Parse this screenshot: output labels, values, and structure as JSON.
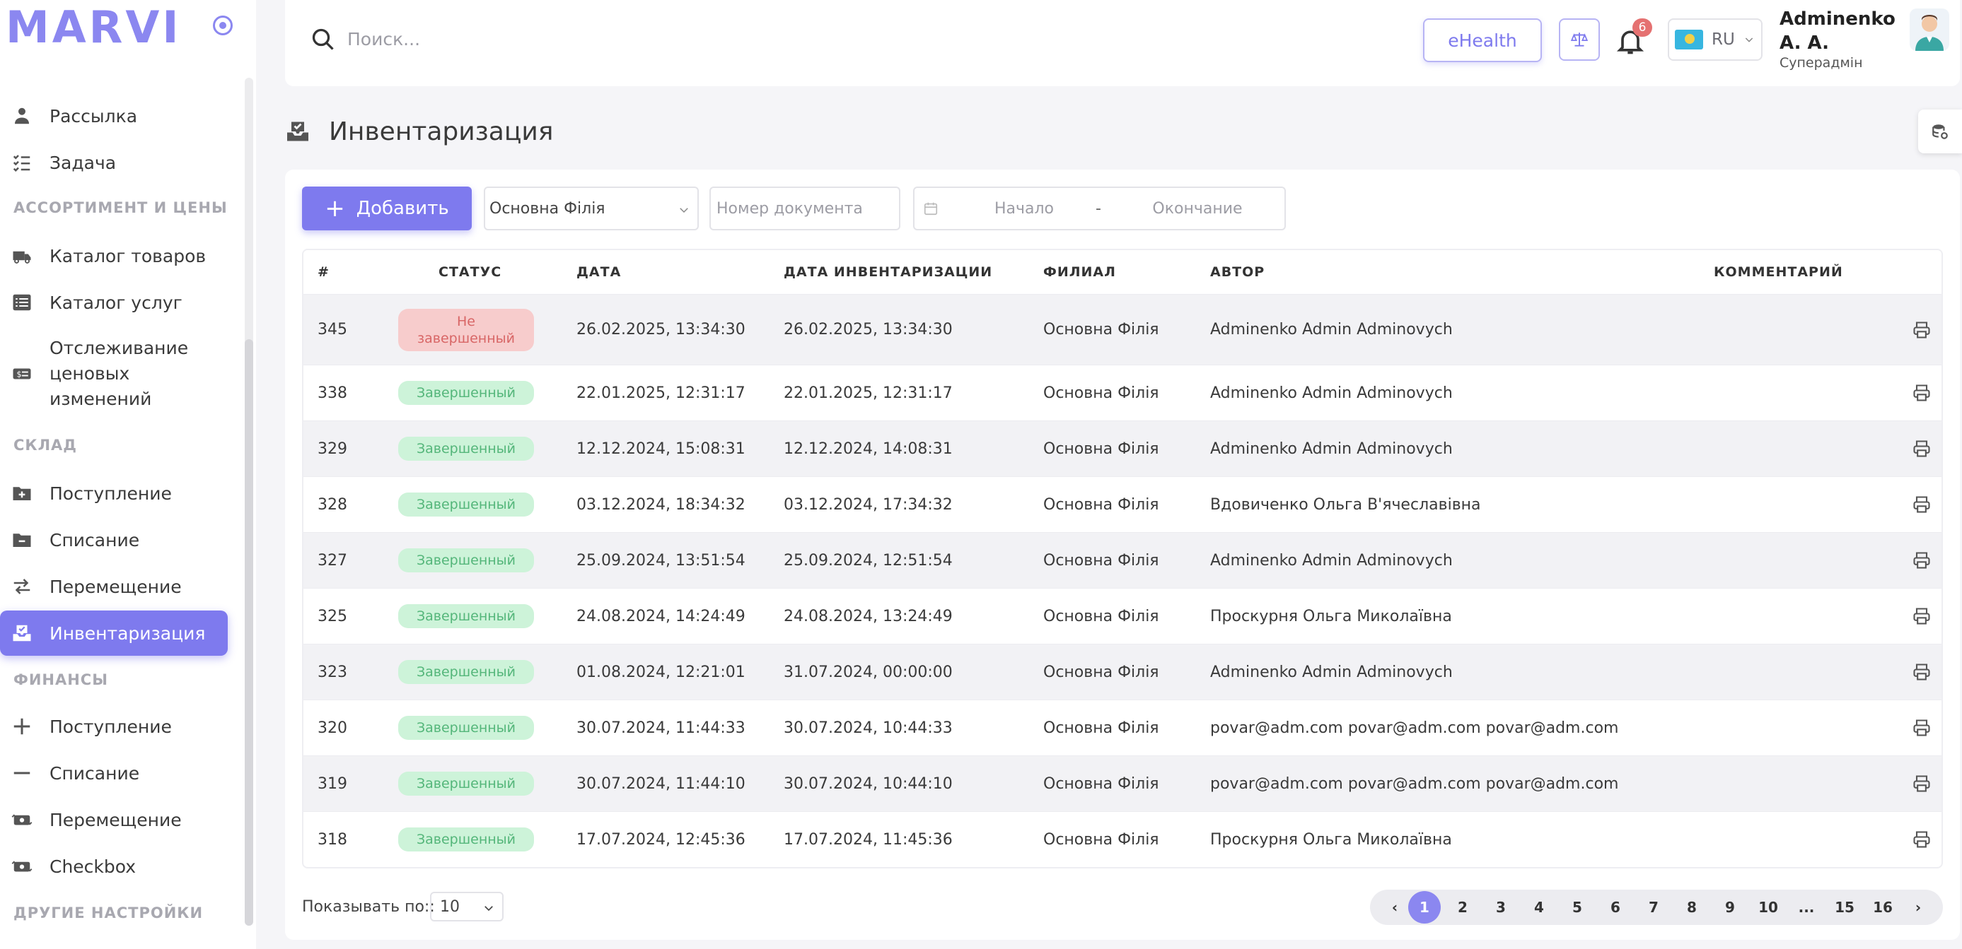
{
  "logo": "MARVI",
  "sidebar": {
    "items": [
      {
        "label": "Рассылка",
        "icon": "person-icon"
      },
      {
        "label": "Задача",
        "icon": "checklist-icon"
      },
      {
        "label": "Каталог товаров",
        "icon": "truck-icon"
      },
      {
        "label": "Каталог услуг",
        "icon": "list-icon"
      },
      {
        "label_lines": [
          "Отслеживание",
          "ценовых",
          "изменений"
        ],
        "icon": "money-icon"
      },
      {
        "label": "Поступление",
        "icon": "folder-plus-icon"
      },
      {
        "label": "Списание",
        "icon": "folder-minus-icon"
      },
      {
        "label": "Перемещение",
        "icon": "transfer-icon"
      },
      {
        "label": "Инвентаризация",
        "icon": "inventory-icon",
        "active": true
      },
      {
        "label": "Поступление",
        "icon": "plus-icon"
      },
      {
        "label": "Списание",
        "icon": "minus-icon"
      },
      {
        "label": "Перемещение",
        "icon": "money-transfer-icon"
      },
      {
        "label": "Checkbox",
        "icon": "cash-icon"
      }
    ],
    "sections": {
      "assortment": "АССОРТИМЕНТ И ЦЕНЫ",
      "warehouse": "СКЛАД",
      "finance": "ФИНАНСЫ",
      "other": "ДРУГИЕ НАСТРОЙКИ"
    }
  },
  "header": {
    "search_placeholder": "Поиск...",
    "ehealth_label": "eHealth",
    "notifications_count": "6",
    "language": "RU",
    "user_name": "Adminenko A. A.",
    "user_role": "Суперадмін"
  },
  "page": {
    "title": "Инвентаризация"
  },
  "toolbar": {
    "add_label": "Добавить",
    "branch_value": "Основна Філія",
    "doc_placeholder": "Номер документа",
    "date_start": "Начало",
    "date_sep": "-",
    "date_end": "Окончание"
  },
  "table": {
    "headers": {
      "num": "#",
      "status": "СТАТУС",
      "date": "ДАТА",
      "inv_date": "ДАТА ИНВЕНТАРИЗАЦИИ",
      "branch": "ФИЛИАЛ",
      "author": "АВТОР",
      "comment": "КОММЕНТАРИЙ"
    },
    "rows": [
      {
        "num": "345",
        "status": "Не завершенный",
        "done": false,
        "date": "26.02.2025, 13:34:30",
        "inv_date": "26.02.2025, 13:34:30",
        "branch": "Основна Філія",
        "author": "Adminenko Admin Adminovych"
      },
      {
        "num": "338",
        "status": "Завершенный",
        "done": true,
        "date": "22.01.2025, 12:31:17",
        "inv_date": "22.01.2025, 12:31:17",
        "branch": "Основна Філія",
        "author": "Adminenko Admin Adminovych"
      },
      {
        "num": "329",
        "status": "Завершенный",
        "done": true,
        "date": "12.12.2024, 15:08:31",
        "inv_date": "12.12.2024, 14:08:31",
        "branch": "Основна Філія",
        "author": "Adminenko Admin Adminovych"
      },
      {
        "num": "328",
        "status": "Завершенный",
        "done": true,
        "date": "03.12.2024, 18:34:32",
        "inv_date": "03.12.2024, 17:34:32",
        "branch": "Основна Філія",
        "author": "Вдовиченко Ольга В'ячеславівна"
      },
      {
        "num": "327",
        "status": "Завершенный",
        "done": true,
        "date": "25.09.2024, 13:51:54",
        "inv_date": "25.09.2024, 12:51:54",
        "branch": "Основна Філія",
        "author": "Adminenko Admin Adminovych"
      },
      {
        "num": "325",
        "status": "Завершенный",
        "done": true,
        "date": "24.08.2024, 14:24:49",
        "inv_date": "24.08.2024, 13:24:49",
        "branch": "Основна Філія",
        "author": "Проскурня Ольга Миколаївна"
      },
      {
        "num": "323",
        "status": "Завершенный",
        "done": true,
        "date": "01.08.2024, 12:21:01",
        "inv_date": "31.07.2024, 00:00:00",
        "branch": "Основна Філія",
        "author": "Adminenko Admin Adminovych"
      },
      {
        "num": "320",
        "status": "Завершенный",
        "done": true,
        "date": "30.07.2024, 11:44:33",
        "inv_date": "30.07.2024, 10:44:33",
        "branch": "Основна Філія",
        "author": "povar@adm.com povar@adm.com povar@adm.com"
      },
      {
        "num": "319",
        "status": "Завершенный",
        "done": true,
        "date": "30.07.2024, 11:44:10",
        "inv_date": "30.07.2024, 10:44:10",
        "branch": "Основна Філія",
        "author": "povar@adm.com povar@adm.com povar@adm.com"
      },
      {
        "num": "318",
        "status": "Завершенный",
        "done": true,
        "date": "17.07.2024, 12:45:36",
        "inv_date": "17.07.2024, 11:45:36",
        "branch": "Основна Філія",
        "author": "Проскурня Ольга Миколаївна"
      }
    ]
  },
  "footer": {
    "page_size_label": "Показывать по::",
    "page_size_value": "10",
    "pages": [
      "1",
      "2",
      "3",
      "4",
      "5",
      "6",
      "7",
      "8",
      "9",
      "10",
      "...",
      "15",
      "16"
    ],
    "current_page": "1",
    "prev": "‹",
    "next": "›"
  },
  "colors": {
    "accent": "#7e7aee",
    "done_bg": "#cdf3d9",
    "done_text": "#54b67a",
    "notdone_bg": "#f7cccc",
    "notdone_text": "#d86666"
  }
}
